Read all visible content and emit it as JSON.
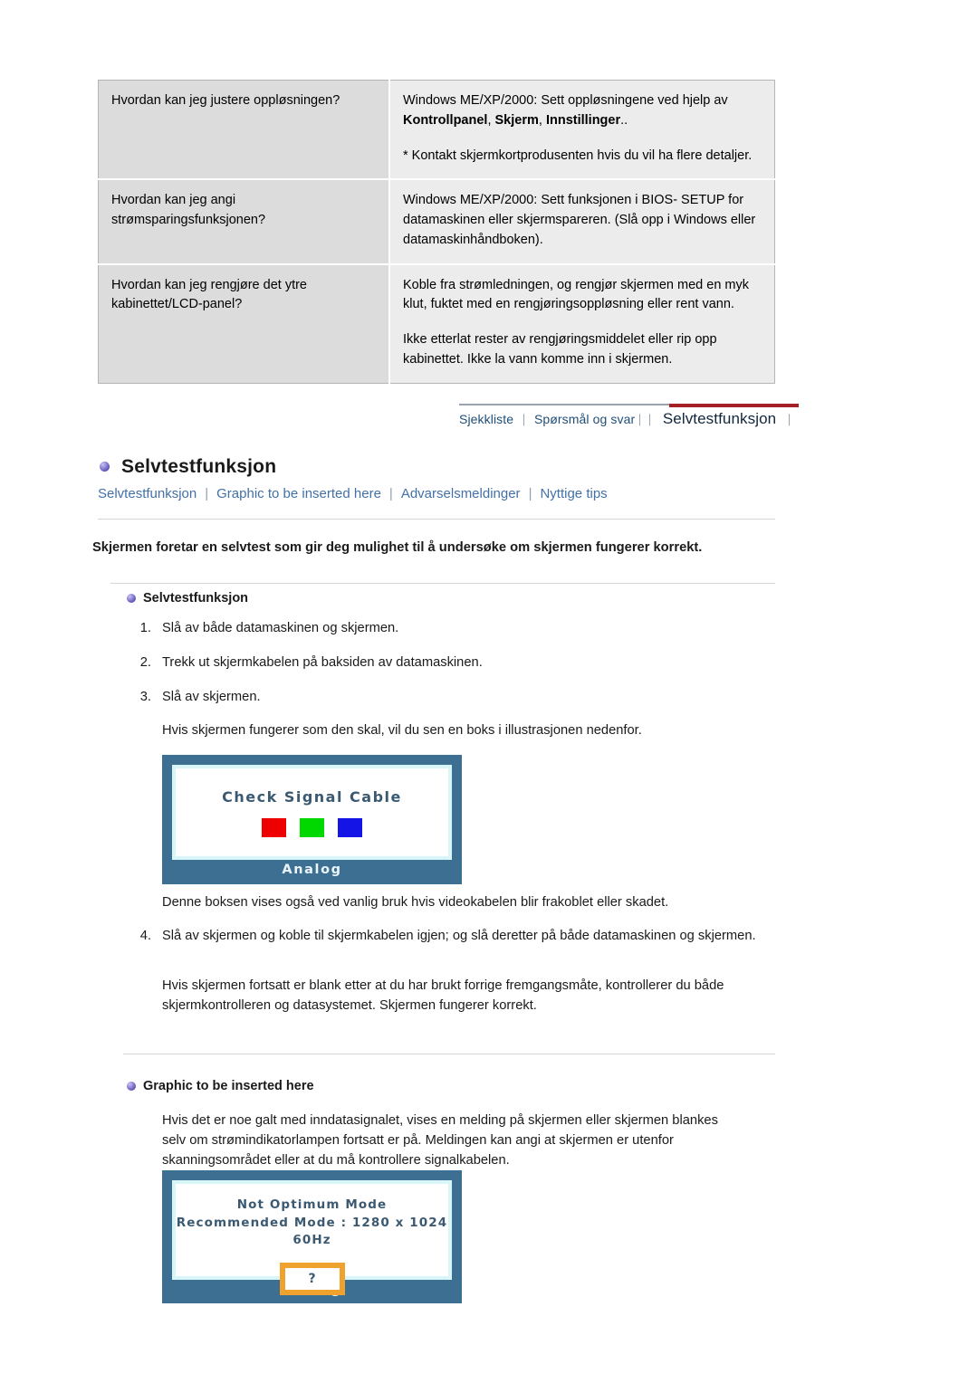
{
  "faq": {
    "rows": [
      {
        "question": "Hvordan kan jeg justere oppløsningen?",
        "answer_1_pre": "Windows ME/XP/2000: Sett oppløsningene ved hjelp av ",
        "answer_1_b1": "Kontrollpanel",
        "answer_1_mid1": ", ",
        "answer_1_b2": "Skjerm",
        "answer_1_mid2": ", ",
        "answer_1_b3": "Innstillinger",
        "answer_1_post": "..",
        "answer_2": "* Kontakt skjermkortprodusenten hvis du vil ha flere detaljer."
      },
      {
        "question": "Hvordan kan jeg angi strømsparingsfunksjonen?",
        "answer_1": "Windows ME/XP/2000: Sett funksjonen i BIOS- SETUP for datamaskinen eller skjermspareren. (Slå opp i Windows eller datamaskinhåndboken)."
      },
      {
        "question": "Hvordan kan jeg rengjøre det ytre kabinettet/LCD-panel?",
        "answer_1": "Koble fra strømledningen, og rengjør skjermen med en myk klut, fuktet med en rengjøringsoppløsning eller rent vann.",
        "answer_2": "Ikke etterlat rester av rengjøringsmiddelet eller rip opp kabinettet. Ikke la vann komme inn i skjermen."
      }
    ]
  },
  "tabbar": {
    "tab_checklist": "Sjekkliste",
    "tab_qa": "Spørsmål og svar",
    "tab_selftest": "Selvtestfunksjon",
    "sep": "⏐",
    "accent_red": "#a51f24",
    "accent_blue": "#1f4e79"
  },
  "header": {
    "title": "Selvtestfunksjon",
    "links": [
      "Selvtestfunksjon",
      "Graphic to be inserted here",
      "Advarselsmeldinger",
      "Nyttige tips"
    ],
    "link_separator": "|",
    "link_color": "#4270a8"
  },
  "main": {
    "lead": "Skjermen foretar en selvtest som gir deg mulighet til å undersøke om skjermen fungerer korrekt.",
    "section_selftest": {
      "heading": "Selvtestfunksjon",
      "steps": [
        {
          "num": "1.",
          "text": "Slå av både datamaskinen og skjermen."
        },
        {
          "num": "2.",
          "text": "Trekk ut skjermkabelen på baksiden av datamaskinen."
        },
        {
          "num": "3.",
          "text": "Slå av skjermen."
        }
      ],
      "after_step3": "Hvis skjermen fungerer som den skal, vil du sen en boks i illustrasjonen nedenfor.",
      "after_image": "Denne boksen vises også ved vanlig bruk hvis videokabelen blir frakoblet eller skadet.",
      "step4_num": "4.",
      "step4_text": "Slå av skjermen og koble til skjermkabelen igjen; og slå deretter på både datamaskinen og skjermen.",
      "closing": "Hvis skjermen fortsatt er blank etter at du har brukt forrige fremgangsmåte, kontrollerer du både skjermkontrolleren og datasystemet. Skjermen fungerer korrekt."
    },
    "section_graphic": {
      "heading": "Graphic to be inserted here",
      "body": "Hvis det er noe galt med inndatasignalet, vises en melding på skjermen eller skjermen blankes selv om strømindikatorlampen fortsatt er på. Meldingen kan angi at skjermen er utenfor skanningsområdet eller at du må kontrollere signalkabelen."
    }
  },
  "illustrations": {
    "check_signal": {
      "message": "Check Signal Cable",
      "label": "Analog",
      "swatches": [
        {
          "name": "red",
          "color": "#ee0000"
        },
        {
          "name": "green",
          "color": "#00d800"
        },
        {
          "name": "blue",
          "color": "#1414e6"
        }
      ],
      "bezel_color": "#3d6f92",
      "inner_border_color": "#d8f6f8"
    },
    "not_optimum": {
      "line1": "Not Optimum Mode",
      "line2": "Recommended Mode : 1280 x 1024  60Hz",
      "question_mark": "?",
      "label": "Analog",
      "box_border_color": "#f0a22e"
    }
  }
}
